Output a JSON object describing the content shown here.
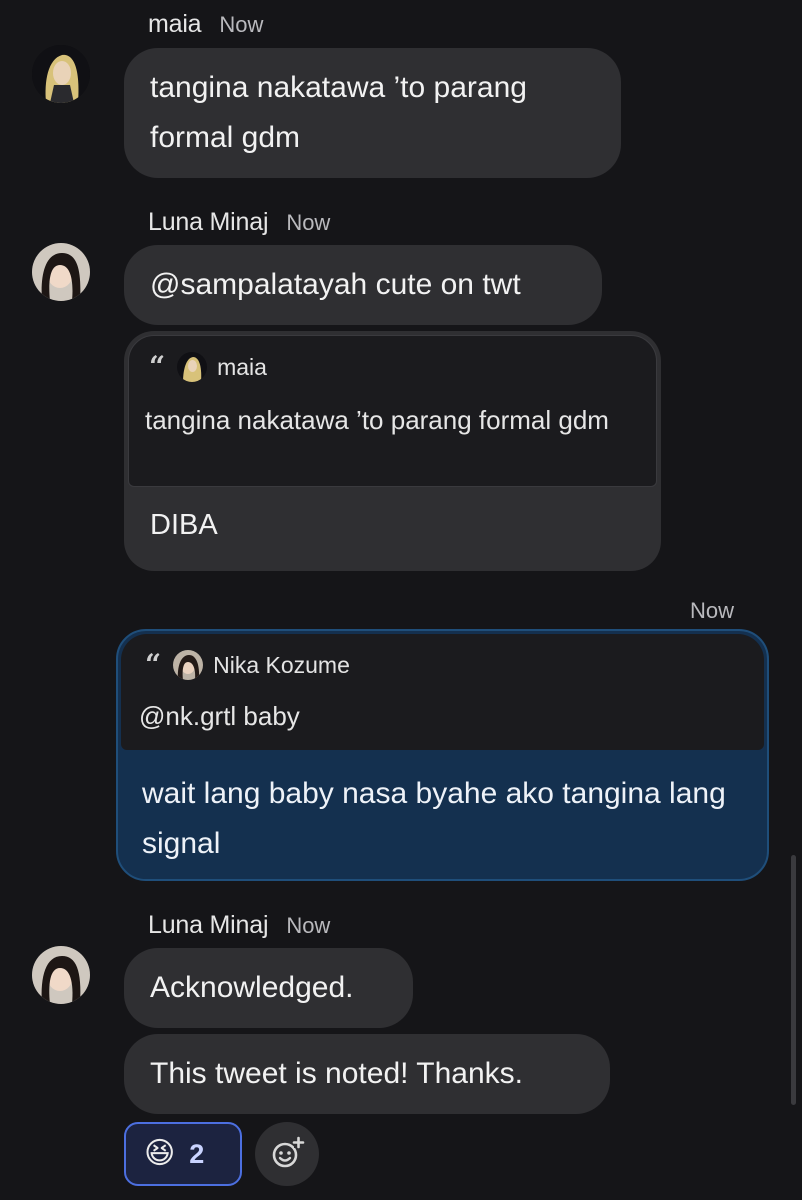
{
  "messages": [
    {
      "author": "maia",
      "time": "Now",
      "text": "tangina nakatawa ’to parang formal gdm"
    },
    {
      "author": "Luna Minaj",
      "time": "Now",
      "text": "@sampalatayah cute on twt",
      "quote": {
        "author": "maia",
        "text": "tangina nakatawa ’to parang formal gdm"
      },
      "reply": "DIBA"
    },
    {
      "own": true,
      "time": "Now",
      "quote": {
        "author": "Nika Kozume",
        "text": "@nk.grtl baby"
      },
      "text": "wait lang baby nasa byahe ako tangina lang signal"
    },
    {
      "author": "Luna Minaj",
      "time": "Now",
      "texts": [
        "Acknowledged.",
        "This tweet is noted! Thanks."
      ],
      "reactions": [
        {
          "emoji": "😆",
          "count": "2"
        }
      ]
    }
  ],
  "icons": {
    "add_reaction": "add-reaction-icon",
    "quote": "quote-icon"
  },
  "colors": {
    "background": "#151518",
    "bubble": "#2f2f32",
    "own_bubble": "#14304f",
    "own_border": "#1f4e7a",
    "reaction_border": "#4c6fe0"
  }
}
